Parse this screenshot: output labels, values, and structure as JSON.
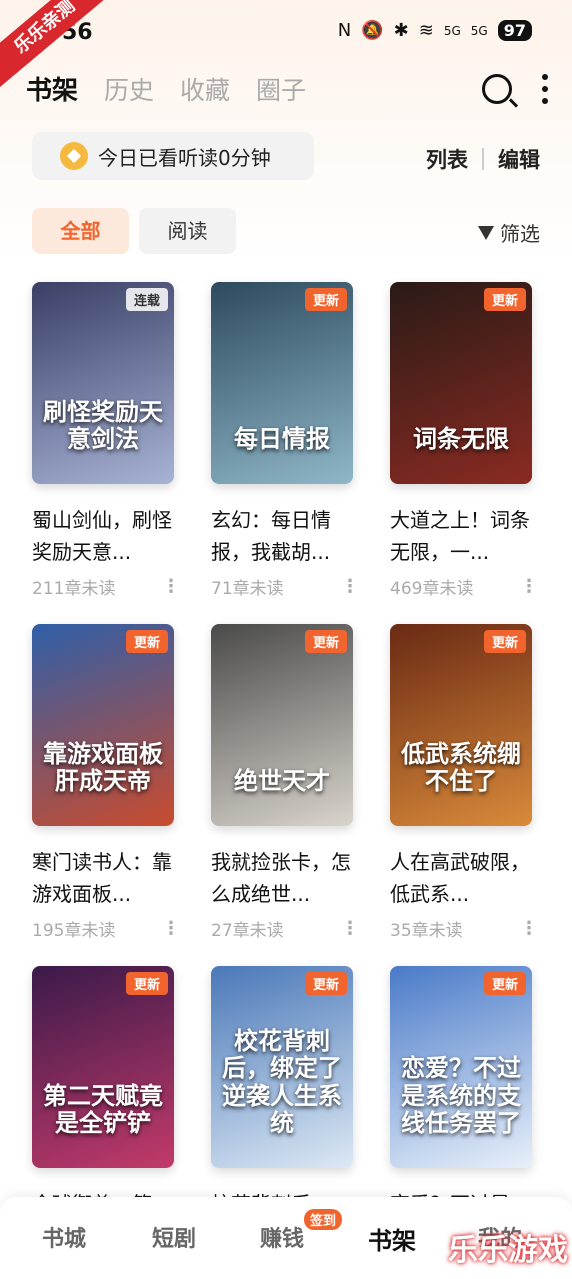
{
  "status": {
    "time": "56",
    "battery": "97",
    "signal1": "5G",
    "signal2": "5G"
  },
  "watermark": {
    "ribbon": "乐乐亲测",
    "logo": "乐乐游戏"
  },
  "tabs": [
    {
      "label": "书架",
      "active": true
    },
    {
      "label": "历史",
      "active": false
    },
    {
      "label": "收藏",
      "active": false
    },
    {
      "label": "圈子",
      "active": false
    }
  ],
  "reading": {
    "text": "今日已看听读0分钟"
  },
  "view": {
    "list": "列表",
    "edit": "编辑"
  },
  "filters": {
    "all": "全部",
    "read": "阅读",
    "filter": "筛选"
  },
  "books": [
    {
      "title": "蜀山剑仙，刷怪奖励天意...",
      "cover_text": "刷怪奖励天意剑法",
      "badge": "连载",
      "unread": "211章未读",
      "c1": "#3a3f66",
      "c2": "#a7b3d4"
    },
    {
      "title": "玄幻：每日情报，我截胡...",
      "cover_text": "每日情报",
      "badge": "更新",
      "unread": "71章未读",
      "c1": "#2d4a5e",
      "c2": "#8fb7c8"
    },
    {
      "title": "大道之上！词条无限，一...",
      "cover_text": "词条无限",
      "badge": "更新",
      "unread": "469章未读",
      "c1": "#2a1a16",
      "c2": "#8a2b22"
    },
    {
      "title": "寒门读书人：靠游戏面板...",
      "cover_text": "靠游戏面板肝成天帝",
      "badge": "更新",
      "unread": "195章未读",
      "c1": "#2f5fa8",
      "c2": "#c94b2e"
    },
    {
      "title": "我就捡张卡，怎么成绝世...",
      "cover_text": "绝世天才",
      "badge": "更新",
      "unread": "27章未读",
      "c1": "#4a4a4a",
      "c2": "#d9d4cc"
    },
    {
      "title": "人在高武破限，低武系...",
      "cover_text": "低武系统绷不住了",
      "badge": "更新",
      "unread": "35章未读",
      "c1": "#6a2a14",
      "c2": "#d98a3a"
    },
    {
      "title": "全球御兽：第...",
      "cover_text": "第二天赋竟是全铲铲",
      "badge": "更新",
      "unread": "",
      "c1": "#3a1a4a",
      "c2": "#c23a6a"
    },
    {
      "title": "校花背刺后...",
      "cover_text": "校花背刺后，绑定了逆袭人生系统",
      "badge": "更新",
      "unread": "",
      "c1": "#4a78b8",
      "c2": "#dce8f4"
    },
    {
      "title": "恋爱？不过是...",
      "cover_text": "恋爱？不过是系统的支线任务罢了",
      "badge": "更新",
      "unread": "",
      "c1": "#4a7ac8",
      "c2": "#e8f0fa"
    }
  ],
  "nav": [
    {
      "label": "书城",
      "active": false
    },
    {
      "label": "短剧",
      "active": false
    },
    {
      "label": "赚钱",
      "active": false,
      "badge": "签到"
    },
    {
      "label": "书架",
      "active": true
    },
    {
      "label": "我的",
      "active": false
    }
  ]
}
